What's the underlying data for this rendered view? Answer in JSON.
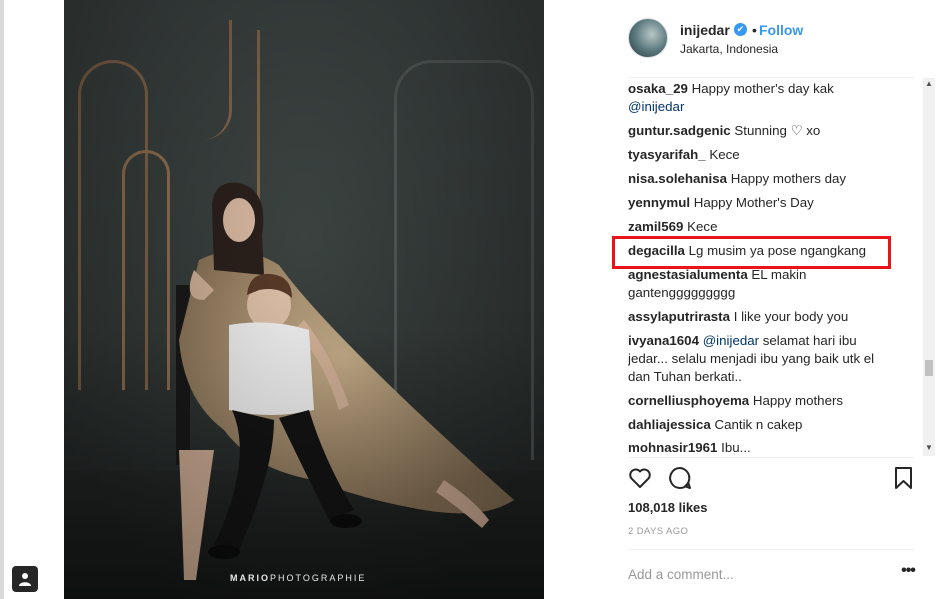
{
  "post": {
    "username": "inijedar",
    "follow_label": "Follow",
    "separator": "•",
    "location": "Jakarta, Indonesia",
    "verified_icon": "✔",
    "photo_watermark_bold": "MARIO",
    "photo_watermark_rest": "PHOTOGRAPHIE"
  },
  "comments": [
    {
      "user": "osaka_29",
      "text": "Happy mother's day kak",
      "text2": "@inijedar"
    },
    {
      "user": "guntur.sadgenic",
      "text": "Stunning ♡ xo"
    },
    {
      "user": "tyasyarifah_",
      "text": "Kece"
    },
    {
      "user": "nisa.solehanisa",
      "text": "Happy mothers day"
    },
    {
      "user": "yennymul",
      "text": "Happy Mother's Day"
    },
    {
      "user": "zamil569",
      "text": "Kece"
    },
    {
      "user": "degacilla",
      "text": "Lg musim ya pose ngangkang"
    },
    {
      "user": "agnestasialumenta",
      "text": "EL makin",
      "text2": "gantenggggggggg"
    },
    {
      "user": "assylaputrirasta",
      "text": "I like your body you"
    },
    {
      "user": "ivyana1604",
      "mention": "@inijedar",
      "text": "selamat hari ibu",
      "text2": "jedar... selalu menjadi ibu yang baik utk el",
      "text3": "dan Tuhan berkati.."
    },
    {
      "user": "cornelliusphoyema",
      "text": "Happy mothers"
    },
    {
      "user": "dahliajessica",
      "text": "Cantik n cakep"
    },
    {
      "user": "mohnasir1961",
      "text": "Ibu..."
    }
  ],
  "actions": {
    "like_icon": "heart-icon",
    "comment_icon": "comment-bubble-icon",
    "save_icon": "bookmark-icon"
  },
  "likes": "108,018 likes",
  "date": "2 DAYS AGO",
  "add_comment_placeholder": "Add a comment...",
  "more_label": "•••",
  "scroll_up": "▲",
  "scroll_down": "▼",
  "colors": {
    "link_blue": "#3897f0",
    "mention_blue": "#003569",
    "highlight_red": "#e8141a"
  }
}
